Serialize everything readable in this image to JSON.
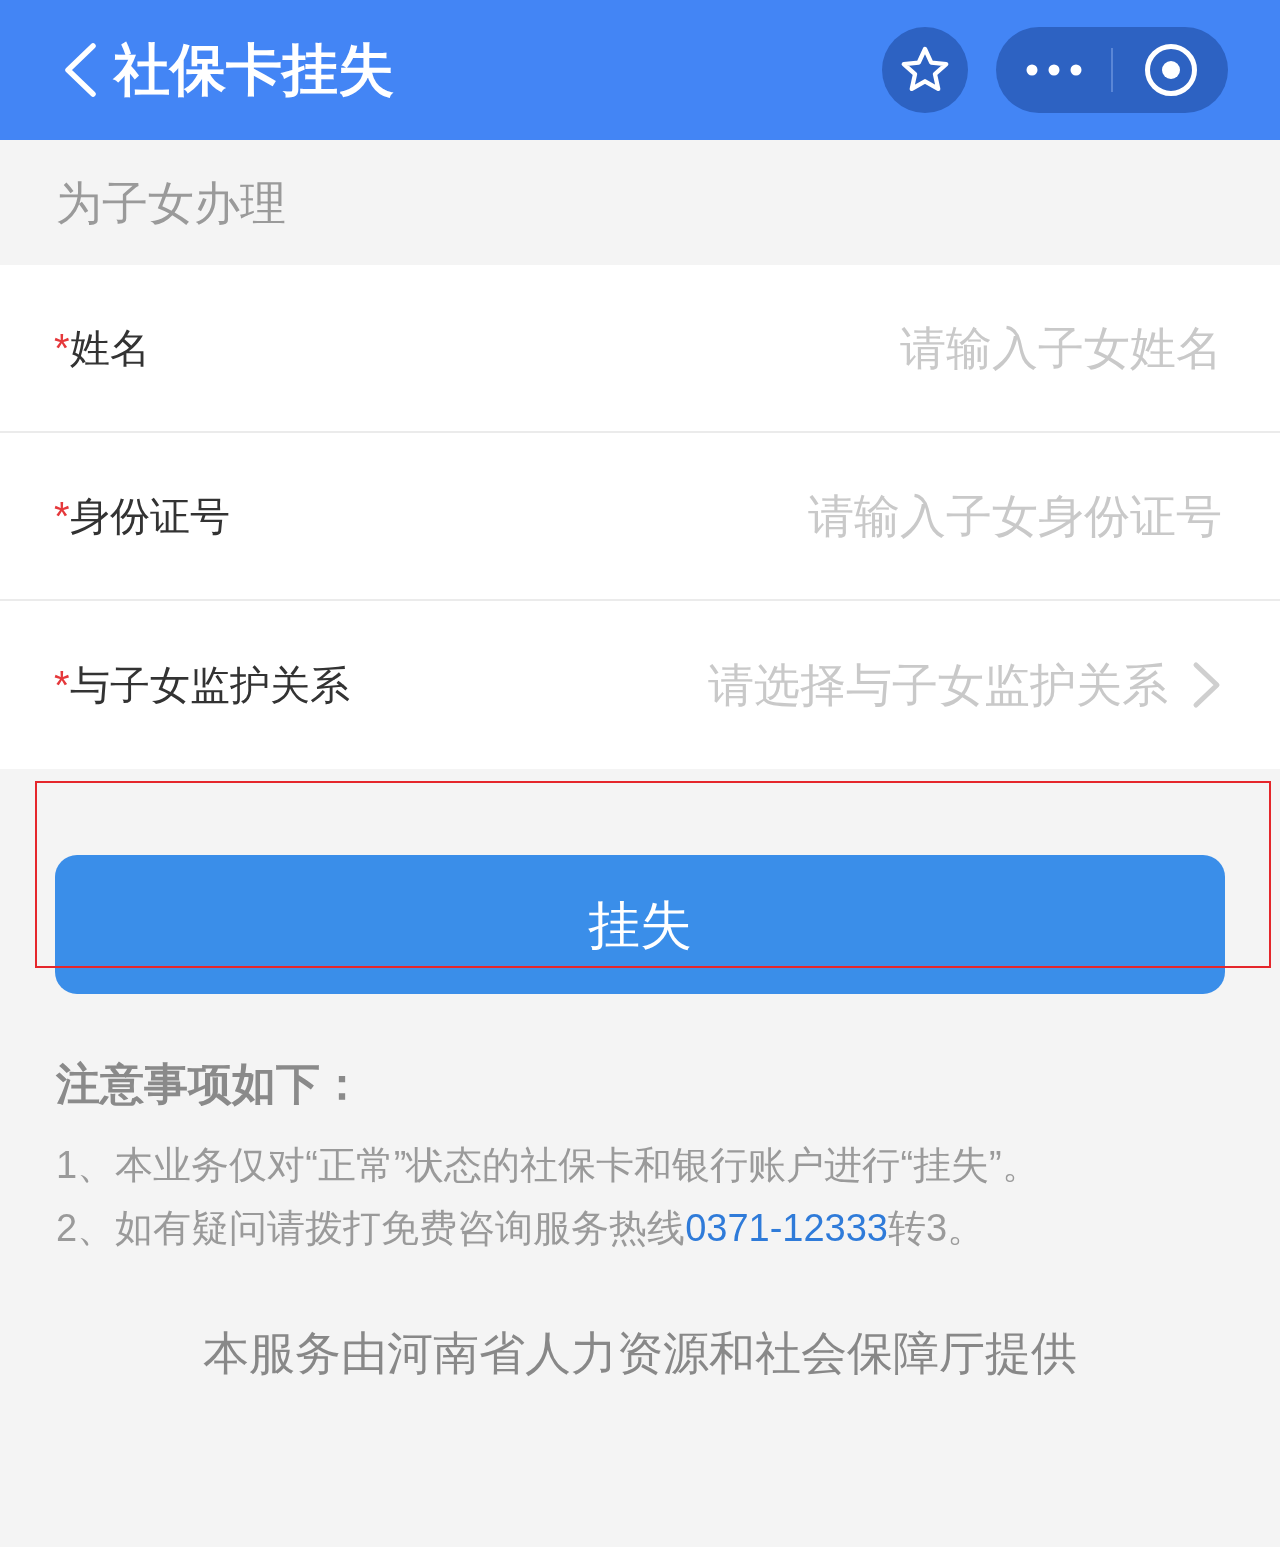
{
  "header": {
    "title": "社保卡挂失"
  },
  "section": {
    "label": "为子女办理"
  },
  "form": {
    "fields": [
      {
        "kind": "input",
        "required": true,
        "required_mark": "*",
        "label": "姓名",
        "placeholder": "请输入子女姓名"
      },
      {
        "kind": "input",
        "required": true,
        "required_mark": "*",
        "label": "身份证号",
        "placeholder": "请输入子女身份证号"
      },
      {
        "kind": "select",
        "required": true,
        "required_mark": "*",
        "label": "与子女监护关系",
        "placeholder": "请选择与子女监护关系"
      }
    ]
  },
  "submit_button": {
    "label": "挂失"
  },
  "notes": {
    "title": "注意事项如下：",
    "items": [
      {
        "text": "1、本业务仅对“正常”状态的社保卡和银行账户进行“挂失”。"
      },
      {
        "text": "2、如有疑问请拨打免费咨询服务热线",
        "link": "0371-12333",
        "text_after": "转3。"
      }
    ]
  },
  "footer": {
    "text": "本服务由河南省人力资源和社会保障厅提供"
  }
}
